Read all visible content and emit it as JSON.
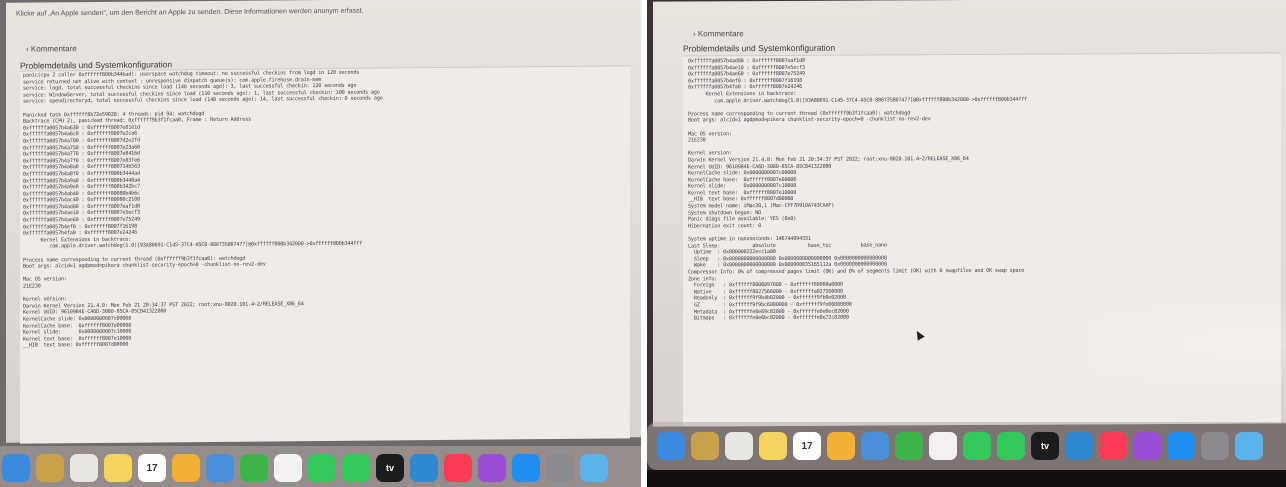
{
  "left": {
    "top_note": "Klicke auf „An Apple senden“, um den Bericht an Apple zu senden. Diese Informationen werden anonym erfasst.",
    "comments_label": "Kommentare",
    "details_heading": "Problemdetails und Systemkonfiguration",
    "log": "panic(cpu 2 caller 0xffffff800b344bad): userspace watchdog timeout: no successful checkins from logd in 120 seconds\nservice returned not alive with context : unresponsive dispatch queue(s): com.apple.firehose.drain-mem\nservice: logd, total successful checkins since load (140 seconds ago): 3, last successful checkin: 120 seconds ago\nservice: WindowServer, total successful checkins since load (110 seconds ago): 1, last successful checkin: 100 seconds ago\nservice: opendirectoryd, total successful checkins since load (140 seconds ago): 14, last successful checkin: 0 seconds ago\n\nPanicked task 0xffffff8b72e59020: 4 threads: pid 94: watchdogd\nBacktrace (CPU 2), panicked thread: 0xffffff9b3f1fcaa0, Frame : Return Address\n0xffffffa0057b4a630 : 0xffffff8007e81e1d\n0xffffffa0057b4a6c0 : 0xffffff8007e2ca6\n0xffffffa0057b4a700 : 0xffffff8007d2e2fd\n0xffffffa0057b4a750 : 0xffffff8007e23a60\n0xffffffa0057b4a770 : 0xffffff8007e8416d\n0xffffffa0057b4a7f0 : 0xffffff8007e83fe6\n0xffffffa0057b4a8a0 : 0xffffff800714b563\n0xffffffa0057b4a8f0 : 0xffffff800b3444ad\n0xffffffa0057b4a9a0 : 0xffffff800b3448a4\n0xffffffa0057b4a9e0 : 0xffffff800b342bc7\n0xffffffa0057b4ab40 : 0xffffff80080b4b6c\n0xffffffa0057b4ac40 : 0xffffff80080c2108\n0xffffffa0057b4ad00 : 0xffffff8007eaf1d8\n0xffffffa0057b4ae10 : 0xffffff8007e5ecf3\n0xffffffa0057b4ae60 : 0xffffff8007e75249\n0xffffffa0057b4ef0 : 0xffffff8007f16198\n0xffffffa0057b4fa0 : 0xffffff8007e24246\n      Kernel Extensions in backtrace:\n         com.apple.driver.watchdog(1.0)[93A80691-C145-37C4-A5C0-88073580747?]@0xffffff800b342000->0xffffff800b344fff\n\nProcess name corresponding to current thread (0xffffff9b3f1fcaa0): watchdogd\nBoot args: alcid=1 agdpmod=pikera chunklist-security-epoch=0 -chunklist-no-rev2-dev\n\nMac OS version:\n21E230\n\nKernel version:\nDarwin Kernel Version 21.4.0: Mon Feb 21 20:34:37 PST 2022; root:xnu-8020.101.4~2/RELEASE_X86_64\nKernel UUID: 9610984E-CA6D-3080-85CA-85C841322080\nKernelCache slide: 0x0000000007c00000\nKernelCache base:  0xffffff8007e00000\nKernel slide:      0x0000000007c10000\nKernel text base:  0xffffff8007e10000\n__HIB  text base: 0xffffff8007d00000"
  },
  "right": {
    "comments_label": "Kommentare",
    "details_heading": "Problemdetails und Systemkonfiguration",
    "log": "0xffffffa0057b4ad00 : 0xffffff8007eaf1d8\n0xffffffa0057b4ae10 : 0xffffff8007e5ecf3\n0xffffffa0057b4ae60 : 0xffffff8007e75249\n0xffffffa0057b4ef0 : 0xffffff8007f16198\n0xffffffa0057b4fa0 : 0xffffff8007e24246\n      Kernel Extensions in backtrace:\n         com.apple.driver.watchdog(1.0)[93A80691-C145-37C4-A5C0-88073580747?]@0xffffff800b342000->0xffffff800b344fff\n\nProcess name corresponding to current thread (0xffffff9b3f1fcaa0): watchdogd\nBoot args: alcid=1 agdpmod=pikera chunklist-security-epoch=0 -chunklist-no-rev2-dev\n\nMac OS version:\n21E230\n\nKernel version:\nDarwin Kernel Version 21.4.0: Mon Feb 21 20:34:37 PST 2022; root:xnu-8020.101.4~2/RELEASE_X86_64\nKernel UUID: 9610984E-CA6D-3080-85CA-85C841322080\nKernelCache slide: 0x0000000007c00000\nKernelCache base:  0xffffff8007e00000\nKernel slide:      0x0000000007c10000\nKernel text base:  0xffffff8007e10000\n__HIB  text base: 0xffffff8007d00000\nSystem model name: iMac20,1 (Mac-CFF7D910A743CAAF)\nSystem shutdown begun: NO\nPanic diags file available: YES (0x0)\nHibernation exit count: 0\n\nSystem uptime in nanoseconds: 146744994331\nLast Sleep:           absolute           base_tsc          base_nano\n  Uptime  : 0x000000222ecc1a00\n  Sleep   : 0x0000000000000000 0x0000000000000000 0x0000000000000000\n  Wake    : 0x0000000000000000 0x000000035165112a 0x0000000000000000\nCompressor Info: 0% of compressed pages limit (OK) and 0% of segments limit (OK) with 0 swapfiles and OK swap space\nZone info:\n  Foreign   : 0xffffff8006097000 - 0xffffff80060a0000\n  Native    : 0xffffff8027566000 - 0xffffffa027566000\n  Readonly  : 0xffffff9f9b4b02000 - 0xffffff9fb0e02000\n  GZ        : 0xffffff9f9bc6000000 - 0xffffff9fe06000000\n  Metadata  : 0xffffffe0e69c82000 - 0xffffffe0e6ec82000\n  Bitmaps   : 0xffffffe0e6bc82000 - 0xffffffe0e72c82000"
  },
  "dock": {
    "apps": [
      {
        "icon": "finder-icon",
        "color": "#3a8be0",
        "label": ""
      },
      {
        "icon": "launchpad-icon",
        "color": "#c8a24a",
        "label": ""
      },
      {
        "icon": "safari-icon",
        "color": "#e8e6e0",
        "label": ""
      },
      {
        "icon": "notes-icon",
        "color": "#f4d35e",
        "label": ""
      },
      {
        "icon": "calendar-icon",
        "color": "#ffffff",
        "label": "17"
      },
      {
        "icon": "stickies-icon",
        "color": "#f2b134",
        "label": ""
      },
      {
        "icon": "preview-icon",
        "color": "#4a90d9",
        "label": ""
      },
      {
        "icon": "numbers-icon",
        "color": "#3bb54a",
        "label": ""
      },
      {
        "icon": "photos-icon",
        "color": "#f1f1f1",
        "label": ""
      },
      {
        "icon": "facetime-icon",
        "color": "#34c759",
        "label": ""
      },
      {
        "icon": "messages-icon",
        "color": "#34c759",
        "label": ""
      },
      {
        "icon": "appletv-icon",
        "color": "#1c1c1e",
        "label": "tv"
      },
      {
        "icon": "keynote-icon",
        "color": "#2f88d0",
        "label": ""
      },
      {
        "icon": "music-icon",
        "color": "#fa3c55",
        "label": ""
      },
      {
        "icon": "podcasts-icon",
        "color": "#9b4ed6",
        "label": ""
      },
      {
        "icon": "appstore-icon",
        "color": "#1e8ef0",
        "label": ""
      },
      {
        "icon": "systemprefs-icon",
        "color": "#8a8a8e",
        "label": ""
      },
      {
        "icon": "folder-icon",
        "color": "#5bb3ea",
        "label": ""
      }
    ]
  }
}
